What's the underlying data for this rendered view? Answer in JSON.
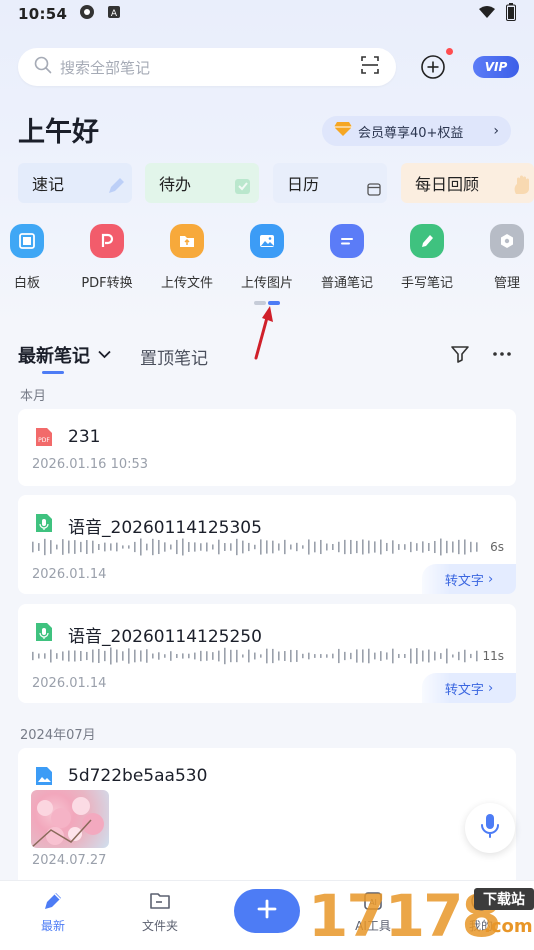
{
  "status_bar": {
    "time": "10:54"
  },
  "search": {
    "placeholder": "搜索全部笔记"
  },
  "vip_label": "VIP",
  "greeting": "上午好",
  "member_pill": {
    "label": "会员尊享40+权益"
  },
  "quick_cards": [
    {
      "label": "速记",
      "color": "#e4ecfb"
    },
    {
      "label": "待办",
      "color": "#e2f5ea"
    },
    {
      "label": "日历",
      "color": "#e8eefb"
    },
    {
      "label": "每日回顾",
      "color": "#fbeee0"
    }
  ],
  "tools": [
    {
      "label": "白板",
      "icon": "whiteboard-icon",
      "color": "#3fa7f5"
    },
    {
      "label": "PDF转换",
      "icon": "pdf-convert-icon",
      "color": "#f25c6b"
    },
    {
      "label": "上传文件",
      "icon": "upload-file-icon",
      "color": "#f7a93b"
    },
    {
      "label": "上传图片",
      "icon": "upload-image-icon",
      "color": "#3c9cf6"
    },
    {
      "label": "普通笔记",
      "icon": "note-icon",
      "color": "#5b7cf7"
    },
    {
      "label": "手写笔记",
      "icon": "handwrite-icon",
      "color": "#3fc27f"
    },
    {
      "label": "管理",
      "icon": "manage-icon",
      "color": "#b7bcc6"
    }
  ],
  "tabs": {
    "active": "最新笔记",
    "inactive": "置顶笔记"
  },
  "sections": {
    "this_month": "本月",
    "older": "2024年07月"
  },
  "notes": [
    {
      "title": "231",
      "date": "2026.01.16 10:53",
      "type": "pdf"
    },
    {
      "title": "语音_20260114125305",
      "date": "2026.01.14",
      "duration": "6s",
      "action": "转文字"
    },
    {
      "title": "语音_20260114125250",
      "date": "2026.01.14",
      "duration": "11s",
      "action": "转文字"
    },
    {
      "title": "5d722be5aa530",
      "date": "2024.07.27",
      "type": "image"
    }
  ],
  "bottom_nav": {
    "recent": "最新",
    "folders": "文件夹",
    "ai_tools": "AI工具",
    "mine": "我的"
  },
  "watermark": {
    "number": "17178",
    "tag": "下载站",
    "suffix": ".com"
  },
  "colors": {
    "accent": "#4d7cf5"
  }
}
